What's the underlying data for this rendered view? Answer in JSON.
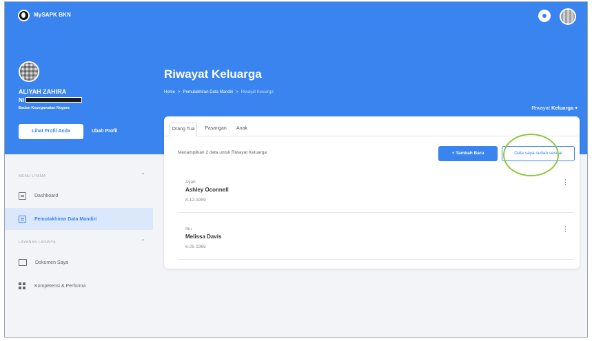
{
  "app": {
    "name": "MySAPK BKN"
  },
  "profile": {
    "name": "ALIYAH ZAHIRA",
    "nip_prefix": "NI",
    "org": "Badan Kepegawaian Negara",
    "view_button": "Lihat Profil Anda",
    "edit_button": "Ubah Profil"
  },
  "sidebar": {
    "section_main": "MENU UTAMA",
    "section_other": "LAYANAN LAINNYA",
    "items": [
      {
        "label": "Dashboard",
        "icon": "dashboard-icon"
      },
      {
        "label": "Pemutakhiran Data Mandiri",
        "icon": "list-icon",
        "active": true
      },
      {
        "label": "Dokumen Saya",
        "icon": "folder-icon"
      },
      {
        "label": "Kompetensi & Performa",
        "icon": "grid-icon"
      }
    ]
  },
  "page": {
    "title": "Riwayat Keluarga",
    "breadcrumb": [
      "Home",
      ">",
      "Pemutakhiran Data Mandiri",
      ">",
      "Riwayat Keluarga"
    ],
    "selector_prefix": "Riwayat",
    "selector_value": "Keluarga"
  },
  "tabs": [
    "Orang Tua",
    "Pasangan",
    "Anak"
  ],
  "content": {
    "summary": "Menampilkan 2 data untuk Riwayat Keluarga",
    "add_button": "+ Tambah Baru",
    "confirm_button": "Data saya sudah sesuai"
  },
  "members": [
    {
      "relation": "Ayah",
      "name": "Ashley Oconnell",
      "dob": "8-12-1959"
    },
    {
      "relation": "Ibu",
      "name": "Melissa Davis",
      "dob": "6-25-1965"
    }
  ],
  "colors": {
    "primary": "#3a84f0",
    "highlight": "#8ec63f"
  }
}
